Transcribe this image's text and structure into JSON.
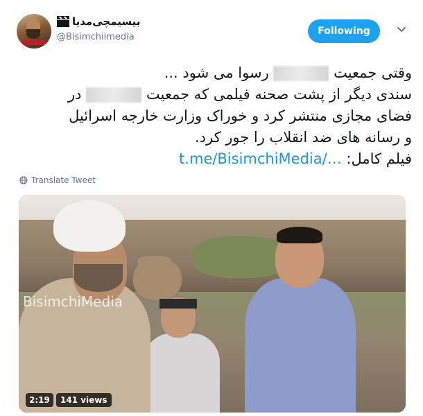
{
  "author": {
    "display_name": "بیسیمچی‌مدیا",
    "handle": "@Bisimchiimedia",
    "name_emoji_icon": "clapperboard-icon"
  },
  "follow_button": {
    "label": "Following",
    "color": "#1da1f2"
  },
  "tweet": {
    "lines": [
      "وقتی جمعیت [censored] رسوا می شود ...",
      "سندی دیگر از پشت صحنه فیلمی که جمعیت [censored] در",
      "فضای مجازی منتشر کرد و خوراک وزارت خارجه اسرائیل",
      "و رسانه های ضد انقلاب را جور کرد."
    ],
    "line1_start": "وقتی جمعیت",
    "line1_end": "رسوا می شود ...",
    "line2_start": "سندی دیگر از پشت صحنه فیلمی که جمعیت",
    "line2_end": "در",
    "line3": "فضای مجازی منتشر کرد و خوراک وزارت خارجه اسرائیل",
    "line4": "و رسانه های ضد انقلاب را جور کرد.",
    "film_label": "فیلم کامل:",
    "link_text": "t.me/BisimchiMedia/…",
    "link_color": "#1b95e0"
  },
  "translate": {
    "label": "Translate Tweet",
    "icon": "globe-icon"
  },
  "video": {
    "watermark": "BisimchiMedia",
    "duration": "2:19",
    "views": "141 views"
  }
}
